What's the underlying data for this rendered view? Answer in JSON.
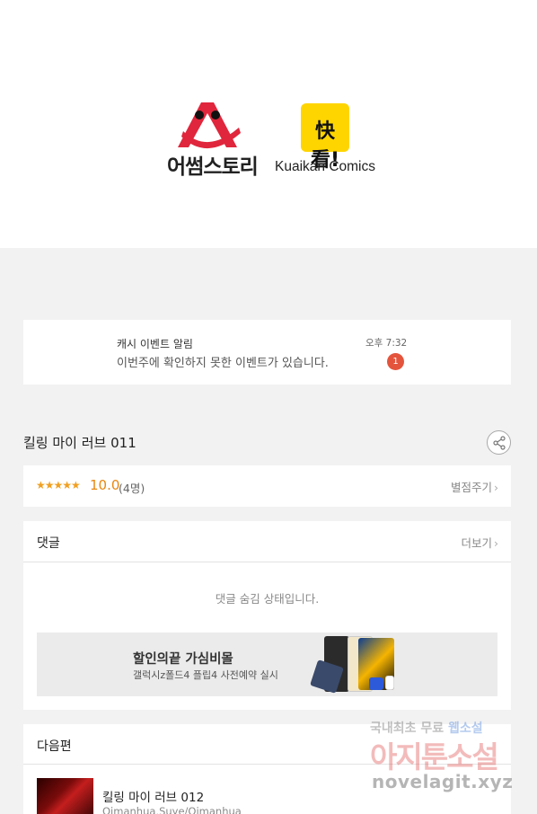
{
  "banner": {
    "partner1_name": "어썸스토리",
    "partner2_glyph": "快看!",
    "partner2_name": "Kuaikan Comics"
  },
  "notification": {
    "title": "캐시 이벤트 알림",
    "message": "이번주에 확인하지 못한 이벤트가 있습니다.",
    "time": "오후 7:32",
    "badge_count": "1"
  },
  "episode": {
    "title": "킬링 마이 러브 011",
    "share_icon": "share-icon"
  },
  "rating": {
    "stars": "★★★★★",
    "value": "10.0",
    "count": "(4명)",
    "rate_label": "별점주기"
  },
  "comments": {
    "title": "댓글",
    "more_label": "더보기",
    "hidden_message": "댓글 숨김 상태입니다."
  },
  "ad": {
    "title": "할인의끝 가심비몰",
    "subtitle": "갤럭시z폴드4 플립4 사전예약 실시"
  },
  "next": {
    "header": "다음편",
    "episode_title": "킬링 마이 러브 012",
    "author": "Qimanhua,Suye/Qimanhua"
  },
  "watermark": {
    "line1_prefix": "국내최초 무료 ",
    "line1_highlight": "웹소설",
    "line2": "아지툰소설",
    "line3": "novelagit.xyz"
  },
  "colors": {
    "background": "#f2f2f2",
    "rating_orange": "#e8870e",
    "badge_red": "#e4543c",
    "kuaikan_yellow": "#ffd500",
    "awesome_red": "#e0263c"
  }
}
